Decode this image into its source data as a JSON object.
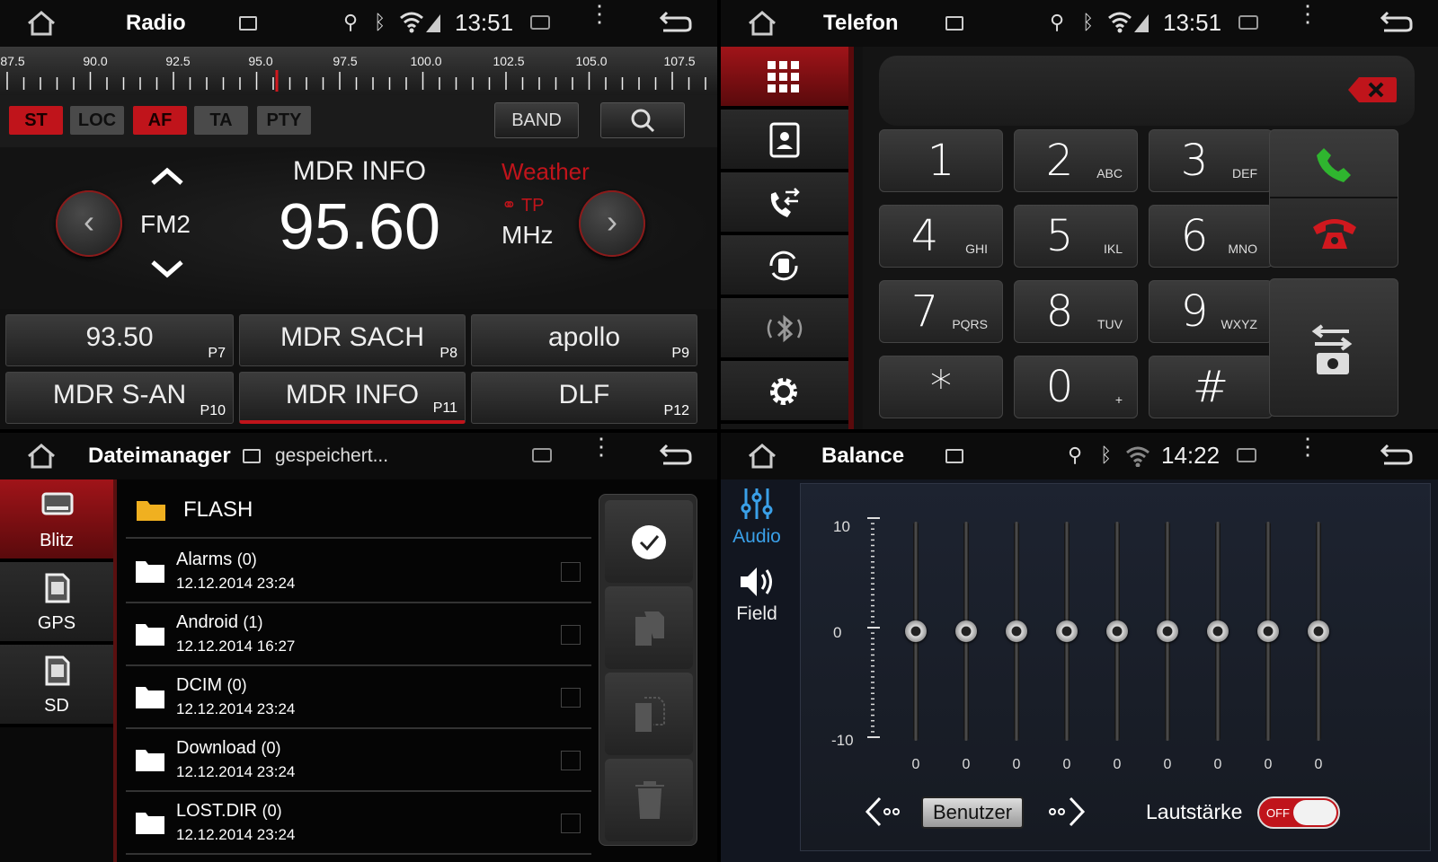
{
  "radio": {
    "title": "Radio",
    "time": "13:51",
    "scale": [
      "87.5",
      "90.0",
      "92.5",
      "95.0",
      "97.5",
      "100.0",
      "102.5",
      "105.0",
      "107.5"
    ],
    "tags": [
      {
        "label": "ST",
        "on": true
      },
      {
        "label": "LOC",
        "on": false
      },
      {
        "label": "AF",
        "on": true
      },
      {
        "label": "TA",
        "on": false
      },
      {
        "label": "PTY",
        "on": false
      }
    ],
    "band_label": "BAND",
    "band": "FM2",
    "station": "MDR INFO",
    "frequency": "95.60",
    "unit": "MHz",
    "weather": "Weather",
    "tp": "TP",
    "presets": [
      {
        "name": "93.50",
        "key": "P7"
      },
      {
        "name": "MDR SACH",
        "key": "P8"
      },
      {
        "name": "apollo",
        "key": "P9"
      },
      {
        "name": "MDR S-AN",
        "key": "P10"
      },
      {
        "name": "MDR INFO",
        "key": "P11"
      },
      {
        "name": "DLF",
        "key": "P12"
      }
    ],
    "accent": "#c0141b"
  },
  "phone": {
    "title": "Telefon",
    "time": "13:51",
    "keys": [
      {
        "d": "1",
        "l": ""
      },
      {
        "d": "2",
        "l": "ABC"
      },
      {
        "d": "3",
        "l": "DEF"
      },
      {
        "d": "4",
        "l": "GHI"
      },
      {
        "d": "5",
        "l": "IKL"
      },
      {
        "d": "6",
        "l": "MNO"
      },
      {
        "d": "7",
        "l": "PQRS"
      },
      {
        "d": "8",
        "l": "TUV"
      },
      {
        "d": "9",
        "l": "WXYZ"
      },
      {
        "d": "*",
        "l": ""
      },
      {
        "d": "0",
        "l": "+"
      },
      {
        "d": "#",
        "l": ""
      }
    ],
    "call_color": "#2fb52f",
    "hangup_color": "#d0181e"
  },
  "files": {
    "title": "Dateimanager",
    "subtitle": "gespeichert...",
    "sources": [
      "Blitz",
      "GPS",
      "SD"
    ],
    "root": "FLASH",
    "rows": [
      {
        "name": "Alarms",
        "count": "(0)",
        "date": "12.12.2014 23:24"
      },
      {
        "name": "Android",
        "count": "(1)",
        "date": "12.12.2014 16:27"
      },
      {
        "name": "DCIM",
        "count": "(0)",
        "date": "12.12.2014 23:24"
      },
      {
        "name": "Download",
        "count": "(0)",
        "date": "12.12.2014 23:24"
      },
      {
        "name": "LOST.DIR",
        "count": "(0)",
        "date": "12.12.2014 23:24"
      }
    ]
  },
  "eq": {
    "title": "Balance",
    "time": "14:22",
    "tabs": [
      "Audio",
      "Field"
    ],
    "scale_top": "10",
    "scale_mid": "0",
    "scale_bot": "-10",
    "bands": [
      0,
      0,
      0,
      0,
      0,
      0,
      0,
      0,
      0
    ],
    "preset": "Benutzer",
    "loudness_label": "Lautstärke",
    "toggle": "OFF",
    "accent": "#3aa0e8"
  }
}
